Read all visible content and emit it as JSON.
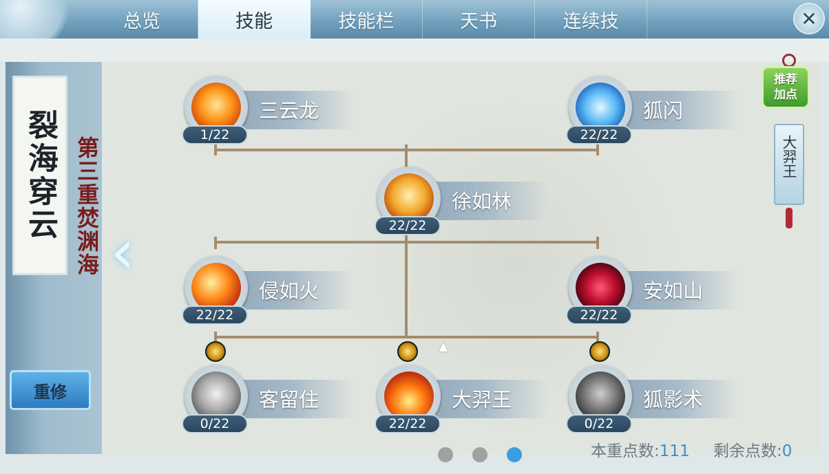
{
  "tabs": [
    {
      "label": "总览",
      "active": false
    },
    {
      "label": "技能",
      "active": true
    },
    {
      "label": "技能栏",
      "active": false
    },
    {
      "label": "天书",
      "active": false
    },
    {
      "label": "连续技",
      "active": false
    }
  ],
  "close_label": "✕",
  "left_panel": {
    "scroll_title": "裂海穿云",
    "realm_title": "第三重焚渊海",
    "reset_button": "重修",
    "prev_arrow": "‹"
  },
  "skills": {
    "s1": {
      "name": "三云龙",
      "level": "1/22",
      "icon": "fire-orb-icon"
    },
    "s2": {
      "name": "狐闪",
      "level": "22/22",
      "icon": "ice-fox-icon"
    },
    "s3": {
      "name": "徐如林",
      "level": "22/22",
      "icon": "golden-shield-icon"
    },
    "s4": {
      "name": "侵如火",
      "level": "22/22",
      "icon": "blaze-claw-icon"
    },
    "s5": {
      "name": "安如山",
      "level": "22/22",
      "icon": "red-shield-icon"
    },
    "s6": {
      "name": "客留住",
      "level": "0/22",
      "icon": "grey-vortex-icon"
    },
    "s7": {
      "name": "大羿王",
      "level": "22/22",
      "icon": "fire-pillar-icon"
    },
    "s8": {
      "name": "狐影术",
      "level": "0/22",
      "icon": "shadow-fox-icon"
    }
  },
  "side": {
    "recommend_button": "推荐\n加点",
    "route_label": "大羿王"
  },
  "footer": {
    "current_points_label": "本重点数:",
    "current_points_value": "111",
    "remaining_points_label": "剩余点数:",
    "remaining_points_value": "0",
    "page_count": 3,
    "active_page": 3
  },
  "colors": {
    "accent_blue": "#3c9de0",
    "realm_red": "#7a1c1c",
    "recommend_green": "#5cb53a"
  }
}
